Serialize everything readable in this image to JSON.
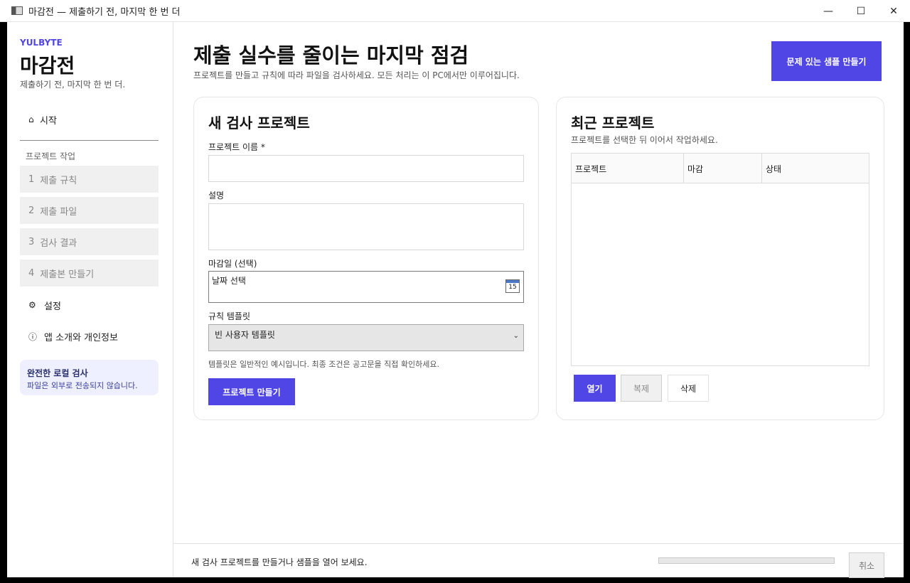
{
  "window": {
    "title": "마감전 — 제출하기 전, 마지막 한 번 더",
    "controls": {
      "minimize": "—",
      "maximize": "☐",
      "close": "✕"
    }
  },
  "sidebar": {
    "brand": "YULBYTE",
    "app_name": "마감전",
    "app_subtitle": "제출하기 전, 마지막 한 번 더.",
    "home": {
      "icon": "home-icon",
      "glyph": "⌂",
      "label": "시작"
    },
    "section_label": "프로젝트 작업",
    "steps": [
      {
        "num": "1",
        "label": "제출 규칙"
      },
      {
        "num": "2",
        "label": "제출 파일"
      },
      {
        "num": "3",
        "label": "검사 결과"
      },
      {
        "num": "4",
        "label": "제출본 만들기"
      }
    ],
    "settings": {
      "icon": "gear-icon",
      "glyph": "⚙",
      "label": "설정"
    },
    "about": {
      "icon": "info-icon",
      "glyph": "ⓘ",
      "label": "앱 소개와 개인정보"
    },
    "info_box": {
      "title": "완전한 로컬 검사",
      "text": "파일은 외부로 전송되지 않습니다."
    }
  },
  "header": {
    "title": "제출 실수를 줄이는 마지막 점검",
    "subtitle": "프로젝트를 만들고 규칙에 따라 파일을 검사하세요. 모든 처리는 이 PC에서만 이루어집니다.",
    "sample_button": "문제 있는 샘플 만들기"
  },
  "new_project": {
    "title": "새 검사 프로젝트",
    "name_label": "프로젝트 이름 *",
    "name_value": "",
    "desc_label": "설명",
    "desc_value": "",
    "deadline_label": "마감일 (선택)",
    "deadline_placeholder": "날짜 선택",
    "calendar_day": "15",
    "template_label": "규칙 템플릿",
    "template_value": "빈 사용자 템플릿",
    "template_chevron": "⌄",
    "hint": "템플릿은 일반적인 예시입니다. 최종 조건은 공고문을 직접 확인하세요.",
    "create_button": "프로젝트 만들기"
  },
  "recent": {
    "title": "최근 프로젝트",
    "subtitle": "프로젝트를 선택한 뒤 이어서 작업하세요.",
    "columns": [
      "프로젝트",
      "마감",
      "상태"
    ],
    "rows": [],
    "open_button": "열기",
    "copy_button": "복제",
    "delete_button": "삭제"
  },
  "status": {
    "message": "새 검사 프로젝트를 만들거나 샘플을 열어 보세요.",
    "progress": 0,
    "cancel_button": "취소"
  },
  "colors": {
    "accent": "#4f46e5",
    "info_bg": "#eef0ff"
  }
}
